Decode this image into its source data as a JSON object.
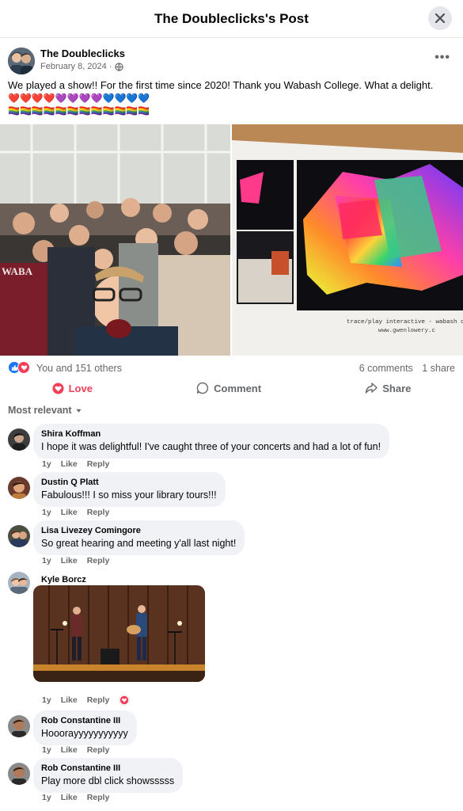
{
  "header": {
    "title": "The Doubleclicks's Post"
  },
  "post": {
    "author": "The Doubleclicks",
    "date": "February 8, 2024 ·",
    "text": "We played a show!! For the first time since 2020! Thank you Wabash College. What a delight.",
    "emoji_line1": "❤️❤️❤️❤️💜💜💜💜💙💙💙💙",
    "emoji_line2": "🏳️‍🌈🏳️‍🌈🏳️‍🌈🏳️‍🌈🏳️‍🌈🏳️‍🌈🏳️‍🌈🏳️‍🌈🏳️‍🌈🏳️‍🌈🏳️‍🌈🏳️‍🌈",
    "photo2_caption1": "trace/play interactive - wabash coll",
    "photo2_caption2": "www.gwenlowery.c",
    "photo1_sign": "WABA"
  },
  "reactions": {
    "summary": "You and 151 others",
    "comments_count": "6 comments",
    "shares_count": "1 share"
  },
  "actions": {
    "love": "Love",
    "comment": "Comment",
    "share": "Share"
  },
  "sort": {
    "label": "Most relevant"
  },
  "comments": [
    {
      "name": "Shira Koffman",
      "text": "I hope it was delightful! I've caught three of your concerts and had a lot of fun!",
      "time": "1y",
      "like": "Like",
      "reply": "Reply"
    },
    {
      "name": "Dustin Q Platt",
      "text": "Fabulous!!! I so miss your library tours!!!",
      "time": "1y",
      "like": "Like",
      "reply": "Reply"
    },
    {
      "name": "Lisa Livezey Comingore",
      "text": "So great hearing and meeting y'all last night!",
      "time": "1y",
      "like": "Like",
      "reply": "Reply"
    },
    {
      "name": "Kyle Borcz",
      "text": "",
      "time": "1y",
      "like": "Like",
      "reply": "Reply"
    },
    {
      "name": "Rob Constantine III",
      "text": "Hooorayyyyyyyyyyy",
      "time": "1y",
      "like": "Like",
      "reply": "Reply"
    },
    {
      "name": "Rob Constantine III",
      "text": "Play more dbl click showsssss",
      "time": "1y",
      "like": "Like",
      "reply": "Reply"
    }
  ],
  "colors": {
    "like_blue": "#1877f2",
    "love_red": "#f33e58",
    "secondary_text": "#65676b",
    "bubble_bg": "#f0f2f5"
  }
}
